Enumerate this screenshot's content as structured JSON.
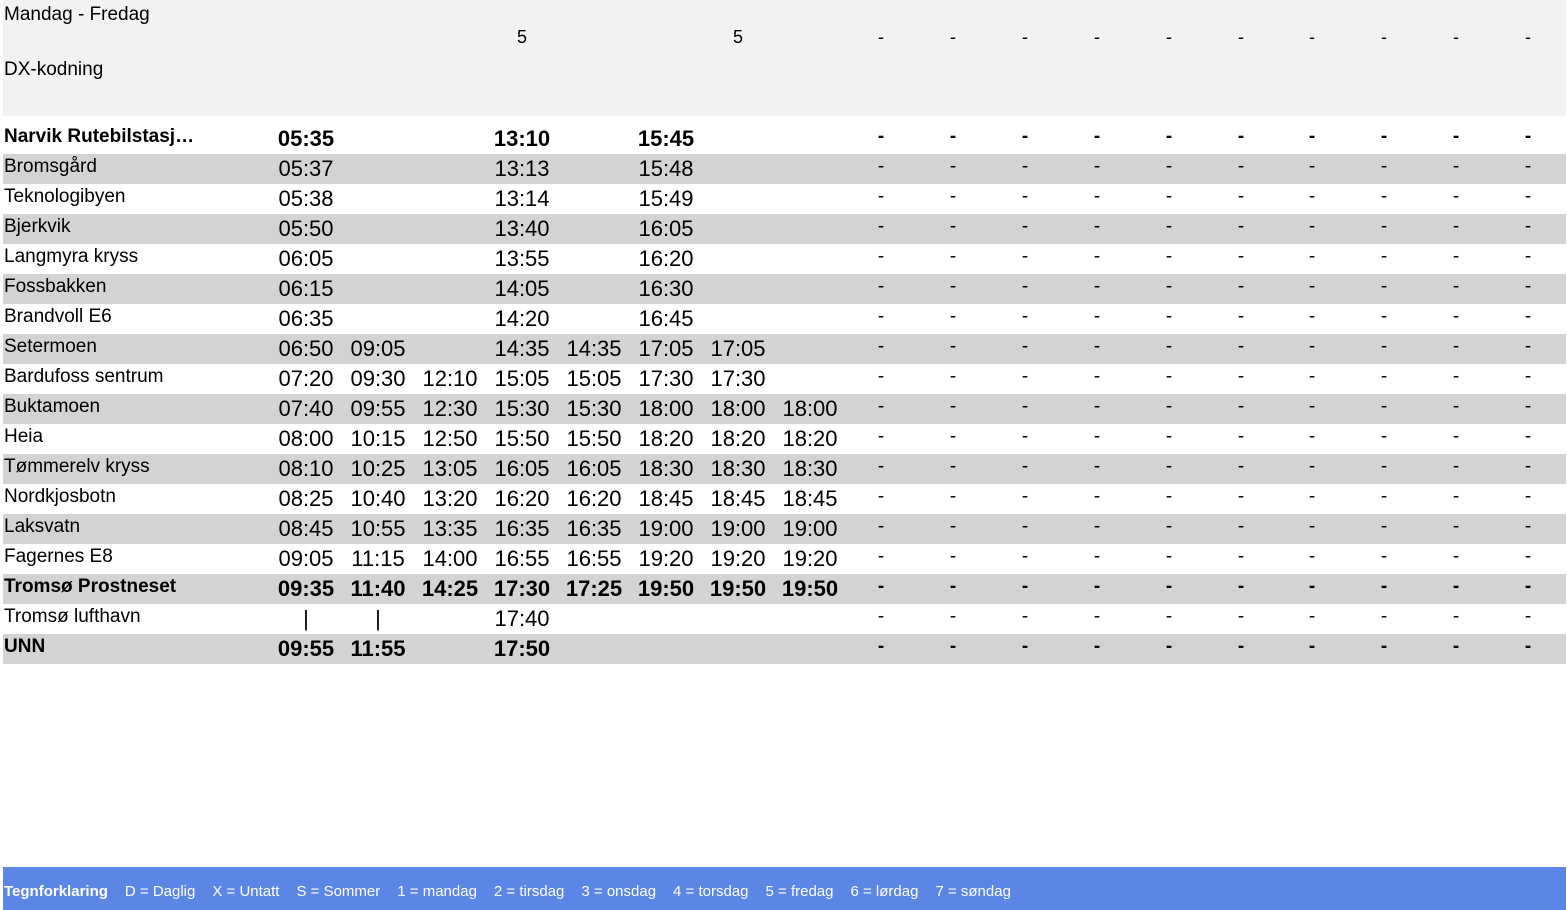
{
  "header": {
    "days_label": "Mandag - Fredag",
    "dx_label": "DX-kodning",
    "columns": [
      "",
      "",
      "",
      "5",
      "",
      "",
      "5",
      "",
      "-",
      "-",
      "-",
      "-",
      "-",
      "-",
      "-",
      "-",
      "-",
      "-"
    ]
  },
  "timetable": {
    "rows": [
      {
        "stop": "Narvik Rutebilstasj…",
        "bold": true,
        "shaded": false,
        "times": [
          "05:35",
          "",
          "",
          "13:10",
          "",
          "15:45",
          "",
          "",
          "-",
          "-",
          "-",
          "-",
          "-",
          "-",
          "-",
          "-",
          "-",
          "-"
        ]
      },
      {
        "stop": "Bromsgård",
        "bold": false,
        "shaded": true,
        "times": [
          "05:37",
          "",
          "",
          "13:13",
          "",
          "15:48",
          "",
          "",
          "-",
          "-",
          "-",
          "-",
          "-",
          "-",
          "-",
          "-",
          "-",
          "-"
        ]
      },
      {
        "stop": "Teknologibyen",
        "bold": false,
        "shaded": false,
        "times": [
          "05:38",
          "",
          "",
          "13:14",
          "",
          "15:49",
          "",
          "",
          "-",
          "-",
          "-",
          "-",
          "-",
          "-",
          "-",
          "-",
          "-",
          "-"
        ]
      },
      {
        "stop": "Bjerkvik",
        "bold": false,
        "shaded": true,
        "times": [
          "05:50",
          "",
          "",
          "13:40",
          "",
          "16:05",
          "",
          "",
          "-",
          "-",
          "-",
          "-",
          "-",
          "-",
          "-",
          "-",
          "-",
          "-"
        ]
      },
      {
        "stop": "Langmyra kryss",
        "bold": false,
        "shaded": false,
        "times": [
          "06:05",
          "",
          "",
          "13:55",
          "",
          "16:20",
          "",
          "",
          "-",
          "-",
          "-",
          "-",
          "-",
          "-",
          "-",
          "-",
          "-",
          "-"
        ]
      },
      {
        "stop": "Fossbakken",
        "bold": false,
        "shaded": true,
        "times": [
          "06:15",
          "",
          "",
          "14:05",
          "",
          "16:30",
          "",
          "",
          "-",
          "-",
          "-",
          "-",
          "-",
          "-",
          "-",
          "-",
          "-",
          "-"
        ]
      },
      {
        "stop": "Brandvoll E6",
        "bold": false,
        "shaded": false,
        "times": [
          "06:35",
          "",
          "",
          "14:20",
          "",
          "16:45",
          "",
          "",
          "-",
          "-",
          "-",
          "-",
          "-",
          "-",
          "-",
          "-",
          "-",
          "-"
        ]
      },
      {
        "stop": "Setermoen",
        "bold": false,
        "shaded": true,
        "times": [
          "06:50",
          "09:05",
          "",
          "14:35",
          "14:35",
          "17:05",
          "17:05",
          "",
          "-",
          "-",
          "-",
          "-",
          "-",
          "-",
          "-",
          "-",
          "-",
          "-"
        ]
      },
      {
        "stop": "Bardufoss sentrum",
        "bold": false,
        "shaded": false,
        "times": [
          "07:20",
          "09:30",
          "12:10",
          "15:05",
          "15:05",
          "17:30",
          "17:30",
          "",
          "-",
          "-",
          "-",
          "-",
          "-",
          "-",
          "-",
          "-",
          "-",
          "-"
        ]
      },
      {
        "stop": "Buktamoen",
        "bold": false,
        "shaded": true,
        "times": [
          "07:40",
          "09:55",
          "12:30",
          "15:30",
          "15:30",
          "18:00",
          "18:00",
          "18:00",
          "-",
          "-",
          "-",
          "-",
          "-",
          "-",
          "-",
          "-",
          "-",
          "-"
        ]
      },
      {
        "stop": "Heia",
        "bold": false,
        "shaded": false,
        "times": [
          "08:00",
          "10:15",
          "12:50",
          "15:50",
          "15:50",
          "18:20",
          "18:20",
          "18:20",
          "-",
          "-",
          "-",
          "-",
          "-",
          "-",
          "-",
          "-",
          "-",
          "-"
        ]
      },
      {
        "stop": "Tømmerelv kryss",
        "bold": false,
        "shaded": true,
        "times": [
          "08:10",
          "10:25",
          "13:05",
          "16:05",
          "16:05",
          "18:30",
          "18:30",
          "18:30",
          "-",
          "-",
          "-",
          "-",
          "-",
          "-",
          "-",
          "-",
          "-",
          "-"
        ]
      },
      {
        "stop": "Nordkjosbotn",
        "bold": false,
        "shaded": false,
        "times": [
          "08:25",
          "10:40",
          "13:20",
          "16:20",
          "16:20",
          "18:45",
          "18:45",
          "18:45",
          "-",
          "-",
          "-",
          "-",
          "-",
          "-",
          "-",
          "-",
          "-",
          "-"
        ]
      },
      {
        "stop": "Laksvatn",
        "bold": false,
        "shaded": true,
        "times": [
          "08:45",
          "10:55",
          "13:35",
          "16:35",
          "16:35",
          "19:00",
          "19:00",
          "19:00",
          "-",
          "-",
          "-",
          "-",
          "-",
          "-",
          "-",
          "-",
          "-",
          "-"
        ]
      },
      {
        "stop": "Fagernes E8",
        "bold": false,
        "shaded": false,
        "times": [
          "09:05",
          "11:15",
          "14:00",
          "16:55",
          "16:55",
          "19:20",
          "19:20",
          "19:20",
          "-",
          "-",
          "-",
          "-",
          "-",
          "-",
          "-",
          "-",
          "-",
          "-"
        ]
      },
      {
        "stop": "Tromsø Prostneset",
        "bold": true,
        "shaded": true,
        "times": [
          "09:35",
          "11:40",
          "14:25",
          "17:30",
          "17:25",
          "19:50",
          "19:50",
          "19:50",
          "-",
          "-",
          "-",
          "-",
          "-",
          "-",
          "-",
          "-",
          "-",
          "-"
        ]
      },
      {
        "stop": "Tromsø lufthavn",
        "bold": false,
        "shaded": false,
        "times": [
          "|",
          "|",
          "",
          "17:40",
          "",
          "",
          "",
          "",
          "-",
          "-",
          "-",
          "-",
          "-",
          "-",
          "-",
          "-",
          "-",
          "-"
        ]
      },
      {
        "stop": "UNN",
        "bold": true,
        "shaded": true,
        "times": [
          "09:55",
          "11:55",
          "",
          "17:50",
          "",
          "",
          "",
          "",
          "-",
          "-",
          "-",
          "-",
          "-",
          "-",
          "-",
          "-",
          "-",
          "-"
        ]
      }
    ]
  },
  "legend": {
    "title": "Tegnforklaring",
    "items": [
      "D = Daglig",
      "X = Untatt",
      "S = Sommer",
      "1 = mandag",
      "2 = tirsdag",
      "3 = onsdag",
      "4 = torsdag",
      "5 = fredag",
      "6 = lørdag",
      "7 = søndag"
    ]
  }
}
